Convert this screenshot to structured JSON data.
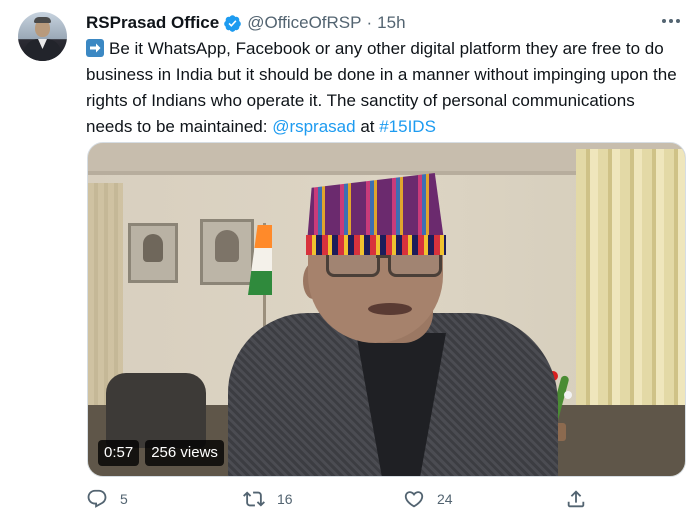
{
  "tweet": {
    "display_name": "RSPrasad Office",
    "handle": "@OfficeOfRSP",
    "separator": "·",
    "time": "15h",
    "text_prefix": "Be it WhatsApp, Facebook or any other digital platform they are free to do business in India but it should be done in a manner without impinging upon the rights of Indians who operate it. The sanctity of personal communications needs to be maintained: ",
    "mention": "@rsprasad",
    "text_mid": " at ",
    "hashtag": "#15IDS",
    "emoji": "arrow-right-emoji"
  },
  "video": {
    "duration": "0:57",
    "views": "256 views"
  },
  "actions": {
    "reply_count": "5",
    "retweet_count": "16",
    "like_count": "24"
  },
  "colors": {
    "link": "#1d9bf0",
    "secondary_text": "#536471",
    "verified": "#1d9bf0"
  },
  "icons": [
    "verified-badge-icon",
    "more-icon",
    "reply-icon",
    "retweet-icon",
    "like-icon",
    "share-icon"
  ]
}
